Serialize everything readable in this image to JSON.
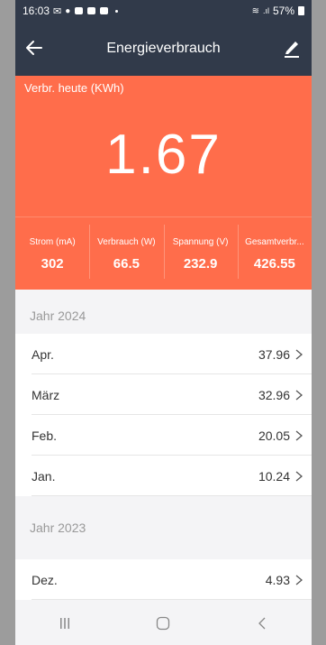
{
  "status_bar": {
    "time": "16:03",
    "battery": "57%"
  },
  "app_bar": {
    "title": "Energieverbrauch",
    "back_icon": "arrow-left-icon",
    "edit_icon": "pencil-icon"
  },
  "hero": {
    "label": "Verbr. heute (KWh)",
    "value": "1.67"
  },
  "stats": [
    {
      "label": "Strom (mA)",
      "value": "302"
    },
    {
      "label": "Verbrauch (W)",
      "value": "66.5"
    },
    {
      "label": "Spannung (V)",
      "value": "232.9"
    },
    {
      "label": "Gesamtverbr...",
      "value": "426.55"
    }
  ],
  "years": [
    {
      "label": "Jahr 2024",
      "months": [
        {
          "label": "Apr.",
          "value": "37.96"
        },
        {
          "label": "März",
          "value": "32.96"
        },
        {
          "label": "Feb.",
          "value": "20.05"
        },
        {
          "label": "Jan.",
          "value": "10.24"
        }
      ]
    },
    {
      "label": "Jahr 2023",
      "months": [
        {
          "label": "Dez.",
          "value": "4.93"
        }
      ]
    }
  ],
  "colors": {
    "header": "#313a4a",
    "accent": "#ff6d4b",
    "background": "#f4f4f6"
  }
}
